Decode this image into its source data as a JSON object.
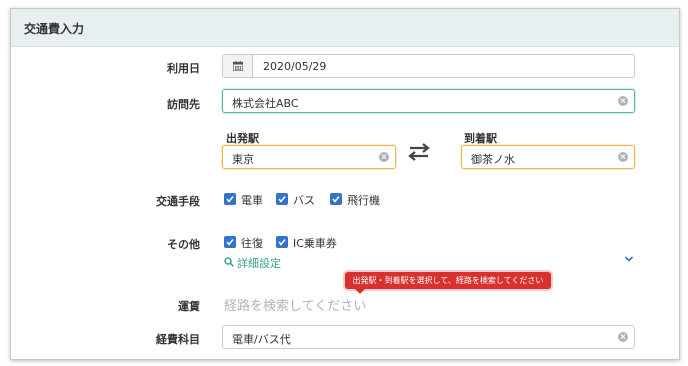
{
  "panel": {
    "title": "交通費入力"
  },
  "usage_date": {
    "label": "利用日",
    "icon": "calendar-icon",
    "value": "2020/05/29"
  },
  "destination": {
    "label": "訪問先",
    "value": "株式会社ABC"
  },
  "route": {
    "departure": {
      "label": "出発駅",
      "value": "東京"
    },
    "arrival": {
      "label": "到着駅",
      "value": "御茶ノ水"
    },
    "swap_icon": "swap-arrows-icon"
  },
  "transport": {
    "label": "交通手段",
    "options": [
      {
        "label": "電車",
        "checked": true
      },
      {
        "label": "バス",
        "checked": true
      },
      {
        "label": "飛行機",
        "checked": true
      }
    ]
  },
  "other": {
    "label": "その他",
    "options": [
      {
        "label": "往復",
        "checked": true
      },
      {
        "label": "IC乗車券",
        "checked": true
      }
    ],
    "detail_link": "詳細設定"
  },
  "tooltip": {
    "text": "出発駅・到着駅を選択して、経路を検索してください"
  },
  "fare": {
    "label": "運賃",
    "placeholder": "経路を検索してください"
  },
  "expense_item": {
    "label": "経費科目",
    "value": "電車/バス代"
  },
  "colors": {
    "accent_teal": "#56b9a8",
    "accent_orange": "#f2b64a",
    "checkbox_blue": "#3275c8",
    "tooltip_red": "#d9322e"
  }
}
